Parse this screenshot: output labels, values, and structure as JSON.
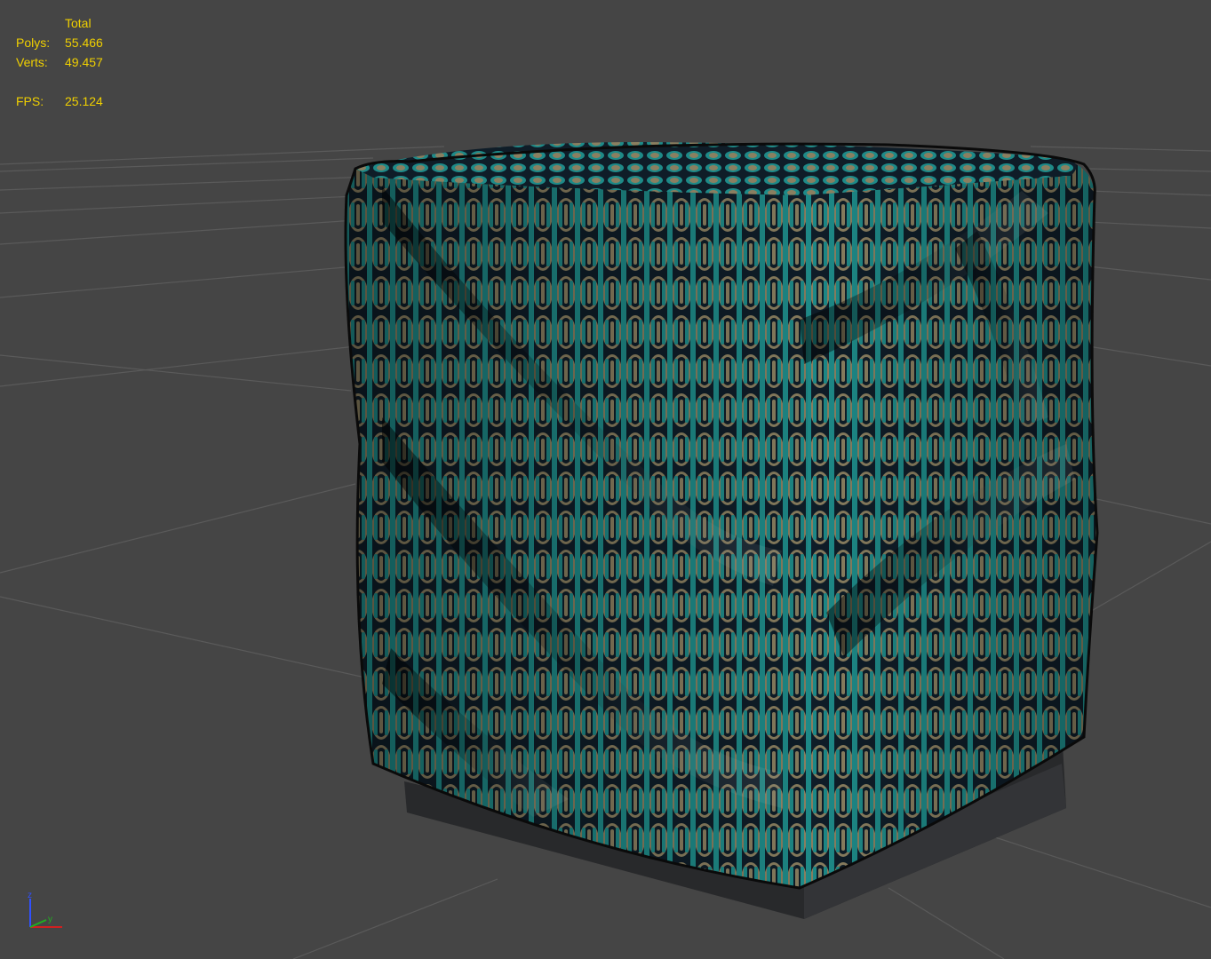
{
  "stats": {
    "header": "Total",
    "polys": {
      "label": "Polys:",
      "value": "55.466"
    },
    "verts": {
      "label": "Verts:",
      "value": "49.457"
    },
    "fps": {
      "label": "FPS:",
      "value": "25.124"
    }
  },
  "gizmo": {
    "z_label": "z",
    "y_label": "y",
    "colors": {
      "x": "#d02020",
      "y": "#20b020",
      "z": "#3050ff"
    }
  },
  "scene": {
    "object": "tufted fabric pouf",
    "grid": true,
    "colors": {
      "background": "#454545",
      "grid_line": "#5a5a5a",
      "fabric_teal": "#1e8a88",
      "fabric_dark": "#0f1d28",
      "fabric_tan": "#8a7f60",
      "base": "#2a2b2d",
      "stats_text": "#f0d000"
    }
  }
}
